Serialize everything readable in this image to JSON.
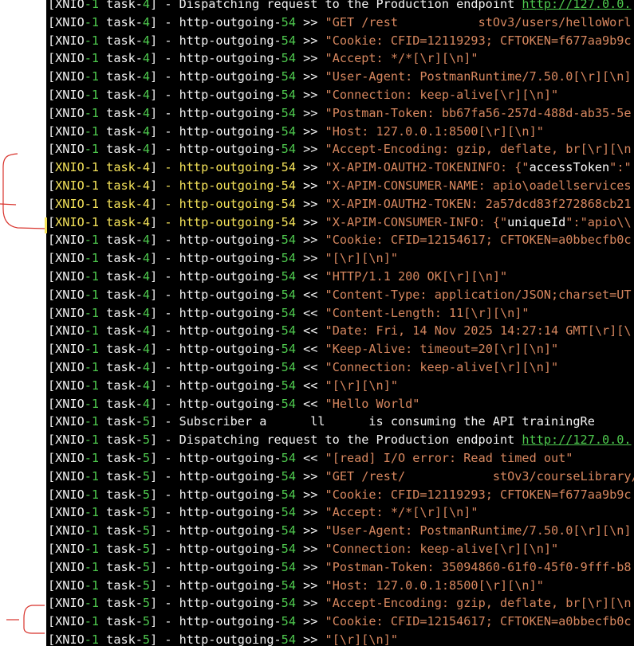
{
  "colors": {
    "background": "#000000",
    "default_text": "#f2f2f2",
    "number_green": "#4ec94e",
    "string_orange": "#d7875f",
    "highlight_yellow": "#f5e35a",
    "annotation_red": "#d8322b"
  },
  "log": [
    {
      "thread": "XNIO",
      "tn": "-1",
      "task": " task-",
      "tkn": "4",
      "conn": "",
      "cn": "",
      "dir": "",
      "text": " - Dispatching request to the Production endpoint ",
      "link": "http://127.0.0.",
      "style": "plain"
    },
    {
      "thread": "XNIO",
      "tn": "-1",
      "task": " task-",
      "tkn": "4",
      "conn": " - http-outgoing-",
      "cn": "54",
      "dir": " >> ",
      "text": "\"GET /rest           stOv3/users/helloWorl",
      "link": "",
      "style": "string"
    },
    {
      "thread": "XNIO",
      "tn": "-1",
      "task": " task-",
      "tkn": "4",
      "conn": " - http-outgoing-",
      "cn": "54",
      "dir": " >> ",
      "text": "\"Cookie: CFID=12119293; CFTOKEN=f677aa9b9c",
      "link": "",
      "style": "string"
    },
    {
      "thread": "XNIO",
      "tn": "-1",
      "task": " task-",
      "tkn": "4",
      "conn": " - http-outgoing-",
      "cn": "54",
      "dir": " >> ",
      "text": "\"Accept: */*[\\r][\\n]\"",
      "link": "",
      "style": "string"
    },
    {
      "thread": "XNIO",
      "tn": "-1",
      "task": " task-",
      "tkn": "4",
      "conn": " - http-outgoing-",
      "cn": "54",
      "dir": " >> ",
      "text": "\"User-Agent: PostmanRuntime/7.50.0[\\r][\\n]",
      "link": "",
      "style": "string"
    },
    {
      "thread": "XNIO",
      "tn": "-1",
      "task": " task-",
      "tkn": "4",
      "conn": " - http-outgoing-",
      "cn": "54",
      "dir": " >> ",
      "text": "\"Connection: keep-alive[\\r][\\n]\"",
      "link": "",
      "style": "string"
    },
    {
      "thread": "XNIO",
      "tn": "-1",
      "task": " task-",
      "tkn": "4",
      "conn": " - http-outgoing-",
      "cn": "54",
      "dir": " >> ",
      "text": "\"Postman-Token: bb67fa56-257d-488d-ab35-5e",
      "link": "",
      "style": "string"
    },
    {
      "thread": "XNIO",
      "tn": "-1",
      "task": " task-",
      "tkn": "4",
      "conn": " - http-outgoing-",
      "cn": "54",
      "dir": " >> ",
      "text": "\"Host: 127.0.0.1:8500[\\r][\\n]\"",
      "link": "",
      "style": "string"
    },
    {
      "thread": "XNIO",
      "tn": "-1",
      "task": " task-",
      "tkn": "4",
      "conn": " - http-outgoing-",
      "cn": "54",
      "dir": " >> ",
      "text": "\"Accept-Encoding: gzip, deflate, br[\\r][\\n",
      "link": "",
      "style": "string"
    },
    {
      "thread": "XNIO",
      "tn": "-1",
      "task": " task-",
      "tkn": "4",
      "conn": " - http-outgoing-",
      "cn": "54",
      "dir": " >> ",
      "text": "\"X-APIM-OAUTH2-TOKENINFO: {\"",
      "text2": "accessToken",
      "text3": "\":\"",
      "link": "",
      "style": "hl"
    },
    {
      "thread": "XNIO",
      "tn": "-1",
      "task": " task-",
      "tkn": "4",
      "conn": " - http-outgoing-",
      "cn": "54",
      "dir": " >> ",
      "text": "\"X-APIM-CONSUMER-NAME: apio\\oadellservices",
      "link": "",
      "style": "hl"
    },
    {
      "thread": "XNIO",
      "tn": "-1",
      "task": " task-",
      "tkn": "4",
      "conn": " - http-outgoing-",
      "cn": "54",
      "dir": " >> ",
      "text": "\"X-APIM-OAUTH2-TOKEN: 2a57dcd83f272868cb21",
      "link": "",
      "style": "hl"
    },
    {
      "thread": "XNIO",
      "tn": "-1",
      "task": " task-",
      "tkn": "4",
      "conn": " - http-outgoing-",
      "cn": "54",
      "dir": " >> ",
      "text": "\"X-APIM-CONSUMER-INFO: {\"",
      "text2": "uniqueId",
      "text3": "\":\"apio\\\\",
      "link": "",
      "style": "hl"
    },
    {
      "thread": "XNIO",
      "tn": "-1",
      "task": " task-",
      "tkn": "4",
      "conn": " - http-outgoing-",
      "cn": "54",
      "dir": " >> ",
      "text": "\"Cookie: CFID=12154617; CFTOKEN=a0bbecfb0c",
      "link": "",
      "style": "string"
    },
    {
      "thread": "XNIO",
      "tn": "-1",
      "task": " task-",
      "tkn": "4",
      "conn": " - http-outgoing-",
      "cn": "54",
      "dir": " >> ",
      "text": "\"[\\r][\\n]\"",
      "link": "",
      "style": "string"
    },
    {
      "thread": "XNIO",
      "tn": "-1",
      "task": " task-",
      "tkn": "4",
      "conn": " - http-outgoing-",
      "cn": "54",
      "dir": " << ",
      "text": "\"HTTP/1.1 200 OK[\\r][\\n]\"",
      "link": "",
      "style": "string"
    },
    {
      "thread": "XNIO",
      "tn": "-1",
      "task": " task-",
      "tkn": "4",
      "conn": " - http-outgoing-",
      "cn": "54",
      "dir": " << ",
      "text": "\"Content-Type: application/JSON;charset=UT",
      "link": "",
      "style": "string"
    },
    {
      "thread": "XNIO",
      "tn": "-1",
      "task": " task-",
      "tkn": "4",
      "conn": " - http-outgoing-",
      "cn": "54",
      "dir": " << ",
      "text": "\"Content-Length: 11[\\r][\\n]\"",
      "link": "",
      "style": "string"
    },
    {
      "thread": "XNIO",
      "tn": "-1",
      "task": " task-",
      "tkn": "4",
      "conn": " - http-outgoing-",
      "cn": "54",
      "dir": " << ",
      "text": "\"Date: Fri, 14 Nov 2025 14:27:14 GMT[\\r][\\",
      "link": "",
      "style": "string"
    },
    {
      "thread": "XNIO",
      "tn": "-1",
      "task": " task-",
      "tkn": "4",
      "conn": " - http-outgoing-",
      "cn": "54",
      "dir": " << ",
      "text": "\"Keep-Alive: timeout=20[\\r][\\n]\"",
      "link": "",
      "style": "string"
    },
    {
      "thread": "XNIO",
      "tn": "-1",
      "task": " task-",
      "tkn": "4",
      "conn": " - http-outgoing-",
      "cn": "54",
      "dir": " << ",
      "text": "\"Connection: keep-alive[\\r][\\n]\"",
      "link": "",
      "style": "string"
    },
    {
      "thread": "XNIO",
      "tn": "-1",
      "task": " task-",
      "tkn": "4",
      "conn": " - http-outgoing-",
      "cn": "54",
      "dir": " << ",
      "text": "\"[\\r][\\n]\"",
      "link": "",
      "style": "string"
    },
    {
      "thread": "XNIO",
      "tn": "-1",
      "task": " task-",
      "tkn": "4",
      "conn": " - http-outgoing-",
      "cn": "54",
      "dir": " << ",
      "text": "\"Hello World\"",
      "link": "",
      "style": "string"
    },
    {
      "thread": "XNIO",
      "tn": "-1",
      "task": " task-",
      "tkn": "5",
      "conn": "",
      "cn": "",
      "dir": "",
      "text": " - Subscriber a      ll      is consuming the API trainingRe",
      "link": "",
      "style": "plain"
    },
    {
      "thread": "XNIO",
      "tn": "-1",
      "task": " task-",
      "tkn": "5",
      "conn": "",
      "cn": "",
      "dir": "",
      "text": " - Dispatching request to the Production endpoint ",
      "link": "http://127.0.0.",
      "style": "plain"
    },
    {
      "thread": "XNIO",
      "tn": "-1",
      "task": " task-",
      "tkn": "5",
      "conn": " - http-outgoing-",
      "cn": "54",
      "dir": " << ",
      "text": "\"[read] I/O error: Read timed out\"",
      "link": "",
      "style": "string"
    },
    {
      "thread": "XNIO",
      "tn": "-1",
      "task": " task-",
      "tkn": "5",
      "conn": " - http-outgoing-",
      "cn": "54",
      "dir": " >> ",
      "text": "\"GET /rest/            stOv3/courseLibrary/s",
      "link": "",
      "style": "string"
    },
    {
      "thread": "XNIO",
      "tn": "-1",
      "task": " task-",
      "tkn": "5",
      "conn": " - http-outgoing-",
      "cn": "54",
      "dir": " >> ",
      "text": "\"Cookie: CFID=12119293; CFTOKEN=f677aa9b9c",
      "link": "",
      "style": "string"
    },
    {
      "thread": "XNIO",
      "tn": "-1",
      "task": " task-",
      "tkn": "5",
      "conn": " - http-outgoing-",
      "cn": "54",
      "dir": " >> ",
      "text": "\"Accept: */*[\\r][\\n]\"",
      "link": "",
      "style": "string"
    },
    {
      "thread": "XNIO",
      "tn": "-1",
      "task": " task-",
      "tkn": "5",
      "conn": " - http-outgoing-",
      "cn": "54",
      "dir": " >> ",
      "text": "\"User-Agent: PostmanRuntime/7.50.0[\\r][\\n]",
      "link": "",
      "style": "string"
    },
    {
      "thread": "XNIO",
      "tn": "-1",
      "task": " task-",
      "tkn": "5",
      "conn": " - http-outgoing-",
      "cn": "54",
      "dir": " >> ",
      "text": "\"Connection: keep-alive[\\r][\\n]\"",
      "link": "",
      "style": "string"
    },
    {
      "thread": "XNIO",
      "tn": "-1",
      "task": " task-",
      "tkn": "5",
      "conn": " - http-outgoing-",
      "cn": "54",
      "dir": " >> ",
      "text": "\"Postman-Token: 35094860-61f0-45f0-9fff-b8",
      "link": "",
      "style": "string"
    },
    {
      "thread": "XNIO",
      "tn": "-1",
      "task": " task-",
      "tkn": "5",
      "conn": " - http-outgoing-",
      "cn": "54",
      "dir": " >> ",
      "text": "\"Host: 127.0.0.1:8500[\\r][\\n]\"",
      "link": "",
      "style": "string"
    },
    {
      "thread": "XNIO",
      "tn": "-1",
      "task": " task-",
      "tkn": "5",
      "conn": " - http-outgoing-",
      "cn": "54",
      "dir": " >> ",
      "text": "\"Accept-Encoding: gzip, deflate, br[\\r][\\n",
      "link": "",
      "style": "string"
    },
    {
      "thread": "XNIO",
      "tn": "-1",
      "task": " task-",
      "tkn": "5",
      "conn": " - http-outgoing-",
      "cn": "54",
      "dir": " >> ",
      "text": "\"Cookie: CFID=12154617; CFTOKEN=a0bbecfb0c",
      "link": "",
      "style": "string"
    },
    {
      "thread": "XNIO",
      "tn": "-1",
      "task": " task-",
      "tkn": "5",
      "conn": " - http-outgoing-",
      "cn": "54",
      "dir": " >> ",
      "text": "\"[\\r][\\n]\"",
      "link": "",
      "style": "string"
    }
  ]
}
